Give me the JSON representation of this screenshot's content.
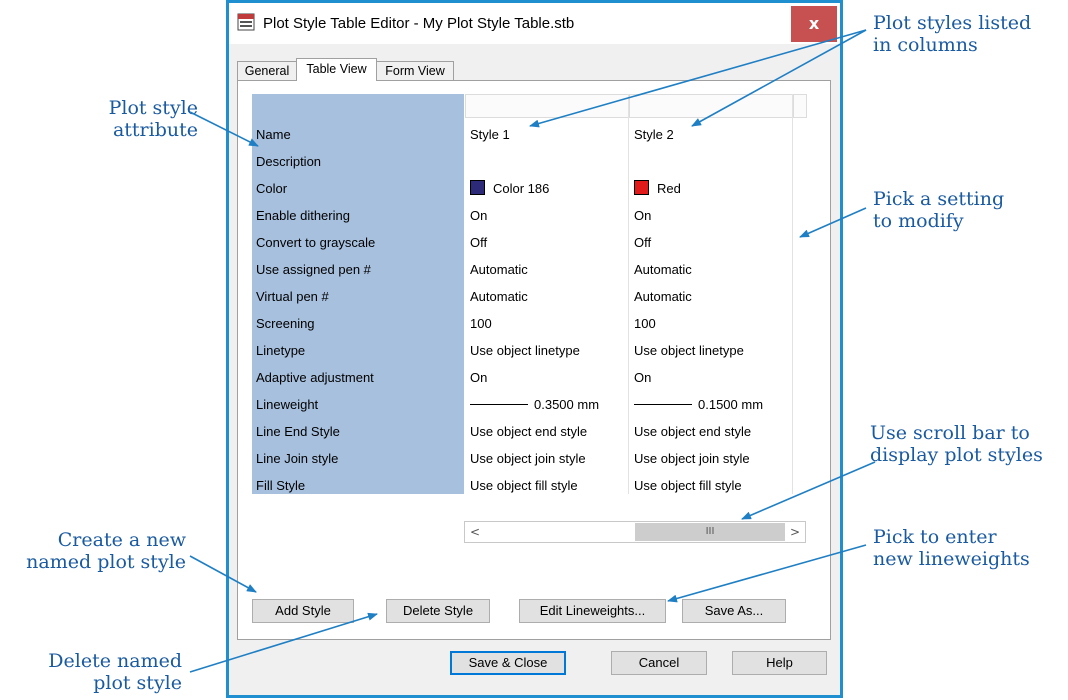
{
  "window": {
    "title": "Plot Style Table Editor - My Plot Style Table.stb",
    "close_label": "x"
  },
  "tabs": [
    {
      "label": "General"
    },
    {
      "label": "Table View",
      "active": true
    },
    {
      "label": "Form View"
    }
  ],
  "table": {
    "attributes": [
      "Name",
      "Description",
      "Color",
      "Enable dithering",
      "Convert to grayscale",
      "Use assigned pen #",
      "Virtual pen #",
      "Screening",
      "Linetype",
      "Adaptive adjustment",
      "Lineweight",
      "Line End Style",
      "Line Join style",
      "Fill Style"
    ],
    "styles": [
      {
        "name": "Style 1",
        "description": "",
        "color": "Color 186",
        "color_hex": "#2e2a7a",
        "dithering": "On",
        "grayscale": "Off",
        "assigned_pen": "Automatic",
        "virtual_pen": "Automatic",
        "screening": "100",
        "linetype": "Use object linetype",
        "adaptive": "On",
        "lineweight": "0.3500 mm",
        "line_end": "Use object end style",
        "line_join": "Use object join style",
        "fill": "Use object fill style"
      },
      {
        "name": "Style 2",
        "description": "",
        "color": "Red",
        "color_hex": "#e31a1a",
        "dithering": "On",
        "grayscale": "Off",
        "assigned_pen": "Automatic",
        "virtual_pen": "Automatic",
        "screening": "100",
        "linetype": "Use object linetype",
        "adaptive": "On",
        "lineweight": "0.1500 mm",
        "line_end": "Use object end style",
        "line_join": "Use object join style",
        "fill": "Use object fill style"
      }
    ]
  },
  "scrollbar": {
    "left_arrow": "<",
    "right_arrow": ">",
    "thumb_grip": "III"
  },
  "buttons": {
    "add_style": "Add Style",
    "delete_style": "Delete Style",
    "edit_lineweights": "Edit Lineweights...",
    "save_as": "Save As...",
    "save_close": "Save & Close",
    "cancel": "Cancel",
    "help": "Help"
  },
  "callouts": {
    "plot_style_attribute": [
      "Plot style",
      "attribute"
    ],
    "plot_styles_listed": [
      "Plot styles listed",
      "in columns"
    ],
    "pick_setting": [
      "Pick a setting",
      "to modify"
    ],
    "scroll_bar": [
      "Use scroll bar to",
      "display plot styles"
    ],
    "new_lineweights": [
      "Pick to enter",
      "new lineweights"
    ],
    "create_new": [
      "Create a new",
      "named plot style"
    ],
    "delete_named": [
      "Delete named",
      "plot style"
    ]
  },
  "colors": {
    "window_border": "#1f8fcf",
    "close_button": "#c75050",
    "attribute_column": "#a7c0de",
    "callout_text": "#1a5aa0",
    "arrow": "#1f7fc4"
  }
}
